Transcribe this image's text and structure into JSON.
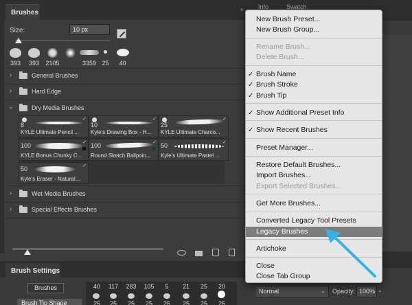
{
  "brushes_panel": {
    "tab_label": "Brushes",
    "size_label": "Size:",
    "size_value": "10 px",
    "recent_brushes": [
      "393",
      "393",
      "2105",
      "",
      "3359",
      "25",
      "40"
    ],
    "groups": [
      {
        "label": "General Brushes",
        "expanded": false
      },
      {
        "label": "Hard Edge",
        "expanded": false
      },
      {
        "label": "Dry Media Brushes",
        "expanded": true
      },
      {
        "label": "Wet Media Brushes",
        "expanded": false
      },
      {
        "label": "Special Effects Brushes",
        "expanded": false
      }
    ],
    "dry_media_tiles": [
      {
        "size": "8",
        "name": "KYLE Ultimate Pencil ..."
      },
      {
        "size": "10",
        "name": "Kyle's Drawing Box - H..."
      },
      {
        "size": "25",
        "name": "KYLE Ultimate Charco..."
      },
      {
        "size": "100",
        "name": "KYLE Bonus Chunky C..."
      },
      {
        "size": "100",
        "name": "Round Sketch Ballpoin..."
      },
      {
        "size": "50",
        "name": "Kyle's Ultimate Pastel ..."
      },
      {
        "size": "50",
        "name": "Kyle's Eraser - Natural..."
      }
    ]
  },
  "brush_settings_panel": {
    "tab_label": "Brush Settings",
    "brushes_button": "Brushes",
    "tip_shape_button": "Brush Tip Shape",
    "preset_sizes_row1": [
      "40",
      "117",
      "283",
      "105",
      "5",
      "21",
      "25",
      "20"
    ],
    "preset_sizes_row2": [
      "25",
      "25",
      "25",
      "25",
      "25",
      "25",
      "25",
      "25"
    ]
  },
  "right_panel": {
    "tab_a": "Info",
    "tab_b": "Swatch",
    "blend_mode": "Normal",
    "opacity_label": "Opacity:",
    "opacity_value": "100%"
  },
  "context_menu": {
    "items": [
      {
        "label": "New Brush Preset...",
        "disabled": false,
        "checked": false
      },
      {
        "label": "New Brush Group...",
        "disabled": false,
        "checked": false
      },
      {
        "label": "Rename Brush...",
        "disabled": true,
        "checked": false
      },
      {
        "label": "Delete Brush...",
        "disabled": true,
        "checked": false
      },
      {
        "label": "Brush Name",
        "disabled": false,
        "checked": true
      },
      {
        "label": "Brush Stroke",
        "disabled": false,
        "checked": true
      },
      {
        "label": "Brush Tip",
        "disabled": false,
        "checked": true
      },
      {
        "label": "Show Additional Preset Info",
        "disabled": false,
        "checked": true
      },
      {
        "label": "Show Recent Brushes",
        "disabled": false,
        "checked": true
      },
      {
        "label": "Preset Manager...",
        "disabled": false,
        "checked": false
      },
      {
        "label": "Restore Default Brushes...",
        "disabled": false,
        "checked": false
      },
      {
        "label": "Import Brushes...",
        "disabled": false,
        "checked": false
      },
      {
        "label": "Export Selected Brushes...",
        "disabled": true,
        "checked": false
      },
      {
        "label": "Get More Brushes...",
        "disabled": false,
        "checked": false
      },
      {
        "label": "Converted Legacy Tool Presets",
        "disabled": false,
        "checked": false
      },
      {
        "label": "Legacy Brushes",
        "disabled": false,
        "checked": false,
        "highlighted": true
      },
      {
        "label": "Artichoke",
        "disabled": false,
        "checked": false
      },
      {
        "label": "Close",
        "disabled": false,
        "checked": false
      },
      {
        "label": "Close Tab Group",
        "disabled": false,
        "checked": false
      }
    ],
    "check_mark": "✓"
  },
  "colors": {
    "menu_highlight": "#7d7d7d",
    "annotation_arrow": "#2fb5e8",
    "panel_bg": "#3c3c3c"
  }
}
